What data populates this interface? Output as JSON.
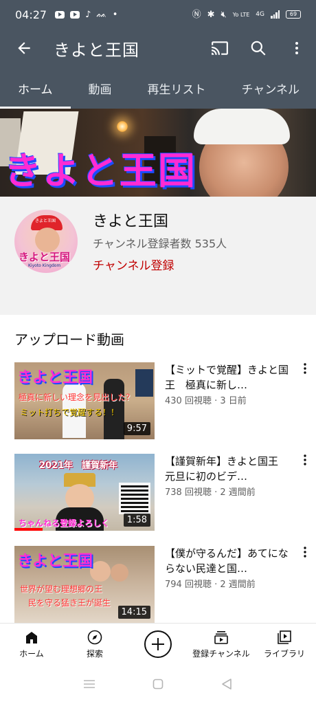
{
  "status_bar": {
    "time": "04:27",
    "network_label": "4G",
    "volte_label": "Yo LTE",
    "battery": "69"
  },
  "app_bar": {
    "title": "きよと王国"
  },
  "tabs": [
    {
      "label": "ホーム",
      "active": true
    },
    {
      "label": "動画",
      "active": false
    },
    {
      "label": "再生リスト",
      "active": false
    },
    {
      "label": "チャンネル",
      "active": false
    }
  ],
  "banner": {
    "text": "きよと王国"
  },
  "avatar": {
    "cap_text": "きよと王国",
    "title": "きよと王国",
    "subtitle": "Kiyoto Kingdom"
  },
  "channel": {
    "name": "きよと王国",
    "subscribers": "チャンネル登録者数 535人",
    "subscribe_label": "チャンネル登録"
  },
  "uploads": {
    "heading": "アップロード動画",
    "videos": [
      {
        "title": "【ミットで覚醒】きよと国王　極真に新し…",
        "meta": "430 回視聴 · 3 日前",
        "duration": "9:57",
        "thumb_title": "きよと王国",
        "thumb_line2": "極真に新しい理念を見出した？",
        "thumb_line3": "ミット打ちで覚醒する！！"
      },
      {
        "title": "【謹賀新年】きよと国王　元旦に初のビデ…",
        "meta": "738 回視聴 · 2 週間前",
        "duration": "1:58",
        "thumb_title": "2021年　謹賀新年",
        "thumb_line2": "ちゃんねる登録よろしく",
        "progress": 0.2
      },
      {
        "title": "【僕が守るんだ】あてにならない民達と国…",
        "meta": "794 回視聴 · 2 週間前",
        "duration": "14:15",
        "thumb_title": "きよと王国",
        "thumb_line2": "世界が望む理想郷の王",
        "thumb_line3": "民を守る猛き王が誕生"
      }
    ]
  },
  "bottom_nav": [
    {
      "label": "ホーム",
      "icon": "home-icon"
    },
    {
      "label": "探索",
      "icon": "explore-icon"
    },
    {
      "label": "",
      "icon": "create-icon"
    },
    {
      "label": "登録チャンネル",
      "icon": "subscriptions-icon"
    },
    {
      "label": "ライブラリ",
      "icon": "library-icon"
    }
  ],
  "colors": {
    "app_bar": "#4a5561",
    "subscribe": "#c00000",
    "channel_info_bg": "#f2f2f2"
  }
}
